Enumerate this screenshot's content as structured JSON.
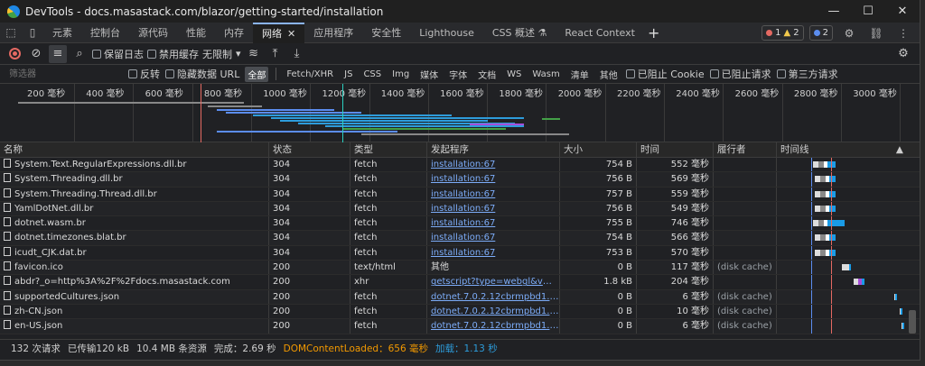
{
  "window": {
    "title": "DevTools - docs.masastack.com/blazor/getting-started/installation",
    "min": "—",
    "max": "☐",
    "close": "✕"
  },
  "tabs": [
    {
      "label": "元素"
    },
    {
      "label": "控制台"
    },
    {
      "label": "源代码"
    },
    {
      "label": "性能"
    },
    {
      "label": "内存"
    },
    {
      "label": "网络",
      "active": true
    },
    {
      "label": "应用程序"
    },
    {
      "label": "安全性"
    },
    {
      "label": "Lighthouse"
    },
    {
      "label": "CSS 概述 ⚗"
    },
    {
      "label": "React Context"
    }
  ],
  "badges": {
    "errors": "1",
    "warnings": "2",
    "info": "2"
  },
  "toolbar": {
    "preserve_log": "保留日志",
    "disable_cache": "禁用缓存",
    "throttle": "无限制"
  },
  "filter": {
    "placeholder": "筛选器",
    "invert": "反转",
    "hide_data_urls": "隐藏数据 URL",
    "types": [
      "全部",
      "Fetch/XHR",
      "JS",
      "CSS",
      "Img",
      "媒体",
      "字体",
      "文档",
      "WS",
      "Wasm",
      "清单",
      "其他"
    ],
    "blocked_cookies": "已阻止 Cookie",
    "blocked_requests": "已阻止请求",
    "third_party": "第三方请求"
  },
  "overview": {
    "ticks": [
      "200 毫秒",
      "400 毫秒",
      "600 毫秒",
      "800 毫秒",
      "1000 毫秒",
      "1200 毫秒",
      "1400 毫秒",
      "1600 毫秒",
      "1800 毫秒",
      "2000 毫秒",
      "2200 毫秒",
      "2400 毫秒",
      "2600 毫秒",
      "2800 毫秒",
      "3000 毫秒"
    ]
  },
  "columns": {
    "name": "名称",
    "status": "状态",
    "type": "类型",
    "initiator": "发起程序",
    "size": "大小",
    "time": "时间",
    "fulfilled_by": "履行者",
    "waterfall": "时间线"
  },
  "rows": [
    {
      "name": "System.Text.RegularExpressions.dll.br",
      "status": "304",
      "type": "fetch",
      "initiator": "installation:67",
      "size": "754 B",
      "time": "552 毫秒",
      "by": ""
    },
    {
      "name": "System.Threading.dll.br",
      "status": "304",
      "type": "fetch",
      "initiator": "installation:67",
      "size": "756 B",
      "time": "569 毫秒",
      "by": ""
    },
    {
      "name": "System.Threading.Thread.dll.br",
      "status": "304",
      "type": "fetch",
      "initiator": "installation:67",
      "size": "757 B",
      "time": "559 毫秒",
      "by": ""
    },
    {
      "name": "YamlDotNet.dll.br",
      "status": "304",
      "type": "fetch",
      "initiator": "installation:67",
      "size": "756 B",
      "time": "549 毫秒",
      "by": ""
    },
    {
      "name": "dotnet.wasm.br",
      "status": "304",
      "type": "fetch",
      "initiator": "installation:67",
      "size": "755 B",
      "time": "746 毫秒",
      "by": ""
    },
    {
      "name": "dotnet.timezones.blat.br",
      "status": "304",
      "type": "fetch",
      "initiator": "installation:67",
      "size": "754 B",
      "time": "566 毫秒",
      "by": ""
    },
    {
      "name": "icudt_CJK.dat.br",
      "status": "304",
      "type": "fetch",
      "initiator": "installation:67",
      "size": "753 B",
      "time": "570 毫秒",
      "by": ""
    },
    {
      "name": "favicon.ico",
      "status": "200",
      "type": "text/html",
      "initiator": "其他",
      "size": "0 B",
      "time": "117 毫秒",
      "by": "(disk cache)"
    },
    {
      "name": "abdr?_o=http%3A%2F%2Fdocs.masastack.com",
      "status": "200",
      "type": "xhr",
      "initiator": "getscript?type=webgl&v=1.0&a...",
      "size": "1.8 kB",
      "time": "204 毫秒",
      "by": ""
    },
    {
      "name": "supportedCultures.json",
      "status": "200",
      "type": "fetch",
      "initiator": "dotnet.7.0.2.12cbrmpbd1.js:5",
      "size": "0 B",
      "time": "6 毫秒",
      "by": "(disk cache)"
    },
    {
      "name": "zh-CN.json",
      "status": "200",
      "type": "fetch",
      "initiator": "dotnet.7.0.2.12cbrmpbd1.js:5",
      "size": "0 B",
      "time": "10 毫秒",
      "by": "(disk cache)"
    },
    {
      "name": "en-US.json",
      "status": "200",
      "type": "fetch",
      "initiator": "dotnet.7.0.2.12cbrmpbd1.js:5",
      "size": "0 B",
      "time": "6 毫秒",
      "by": "(disk cache)"
    }
  ],
  "statusbar": {
    "requests": "132 次请求",
    "transferred": "已传输120 kB",
    "resources": "10.4 MB 条资源",
    "finish": "完成：2.69 秒",
    "dcl": "DOMContentLoaded：656 毫秒",
    "load": "加载：1.13 秒"
  },
  "colors": {
    "accent": "#8ab4f8",
    "link": "#7cacf8",
    "dcl": "#f29900",
    "load": "#2d9cdb"
  }
}
